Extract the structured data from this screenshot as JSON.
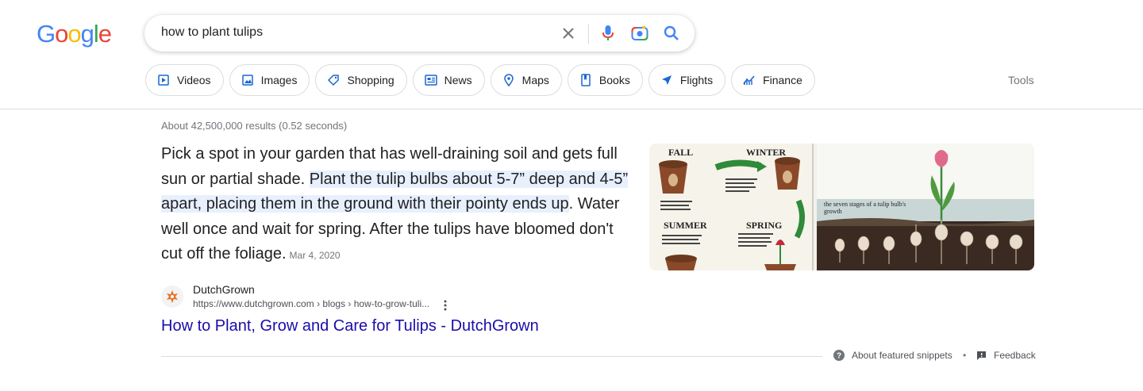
{
  "logo": {
    "letters": [
      "G",
      "o",
      "o",
      "g",
      "l",
      "e"
    ],
    "colors": [
      "#4285F4",
      "#EA4335",
      "#FBBC05",
      "#4285F4",
      "#34A853",
      "#EA4335"
    ]
  },
  "search": {
    "query": "how to plant tulips",
    "icons": [
      "clear-icon",
      "microphone-icon",
      "camera-lens-icon",
      "search-icon"
    ]
  },
  "filters": [
    {
      "label": "Videos",
      "icon": "play-icon"
    },
    {
      "label": "Images",
      "icon": "image-icon"
    },
    {
      "label": "Shopping",
      "icon": "tag-icon"
    },
    {
      "label": "News",
      "icon": "newspaper-icon"
    },
    {
      "label": "Maps",
      "icon": "map-pin-icon"
    },
    {
      "label": "Books",
      "icon": "book-icon"
    },
    {
      "label": "Flights",
      "icon": "airplane-icon"
    },
    {
      "label": "Finance",
      "icon": "chart-icon"
    }
  ],
  "tools_label": "Tools",
  "result_stats": "About 42,500,000 results (0.52 seconds)",
  "snippet": {
    "part1": "Pick a spot in your garden that has well-draining soil and gets full sun or partial shade. ",
    "highlight": "Plant the tulip bulbs about 5-7” deep and 4-5” apart, placing them in the ground with their pointy ends up",
    "part2": ". Water well once and wait for spring. After the tulips have bloomed don't cut off the foliage.",
    "date": "Mar 4, 2020"
  },
  "images": {
    "left": {
      "seasons": [
        "FALL",
        "WINTER",
        "SUMMER",
        "SPRING"
      ]
    },
    "right": {
      "caption_line1": "the seven stages of a tulip bulb's",
      "caption_line2": "growth"
    }
  },
  "source": {
    "name": "DutchGrown",
    "url": "https://www.dutchgrown.com › blogs › how-to-grow-tuli...",
    "title": "How to Plant, Grow and Care for Tulips - DutchGrown"
  },
  "footer": {
    "about": "About featured snippets",
    "separator": "•",
    "feedback": "Feedback"
  },
  "colors": {
    "link": "#1a0dab",
    "highlight": "#e8f0fe",
    "accent_blue": "#4285F4"
  }
}
